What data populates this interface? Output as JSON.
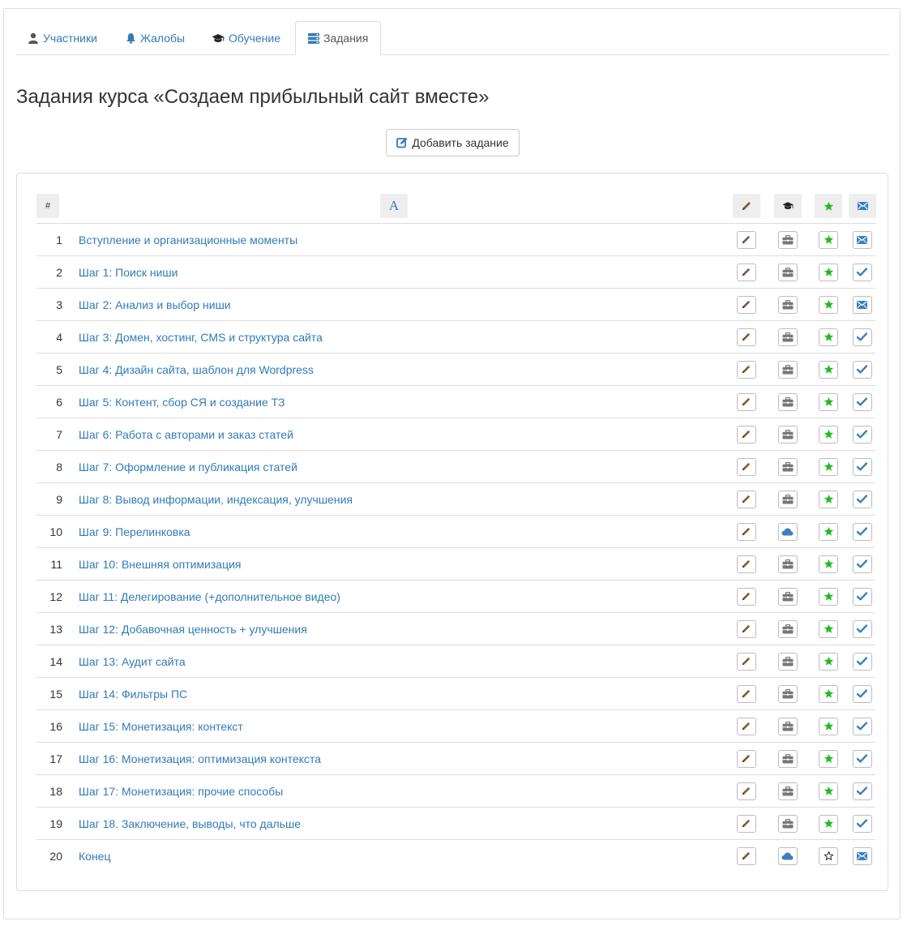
{
  "tabs": [
    {
      "label": "Участники",
      "icon": "user-icon",
      "active": false
    },
    {
      "label": "Жалобы",
      "icon": "bell-icon",
      "active": false
    },
    {
      "label": "Обучение",
      "icon": "graduation-cap-icon",
      "active": false
    },
    {
      "label": "Задания",
      "icon": "tasks-icon",
      "active": true
    }
  ],
  "page": {
    "title": "Задания курса «Создаем прибыльный сайт вместе»",
    "add_button_label": "Добавить задание"
  },
  "table": {
    "headers": {
      "number": "#",
      "title_icon": "font-icon",
      "edit_icon": "pencil-icon",
      "course_icon": "graduation-cap-icon",
      "star_icon": "star-icon",
      "mail_icon": "envelope-icon"
    },
    "rows": [
      {
        "n": "1",
        "title": "Вступление и организационные моменты",
        "type": "briefcase",
        "star": "filled",
        "status": "mail"
      },
      {
        "n": "2",
        "title": "Шаг 1: Поиск ниши",
        "type": "briefcase",
        "star": "filled",
        "status": "check"
      },
      {
        "n": "3",
        "title": "Шаг 2: Анализ и выбор ниши",
        "type": "briefcase",
        "star": "filled",
        "status": "mail"
      },
      {
        "n": "4",
        "title": "Шаг 3: Домен, хостинг, CMS и структура сайта",
        "type": "briefcase",
        "star": "filled",
        "status": "check"
      },
      {
        "n": "5",
        "title": "Шаг 4: Дизайн сайта, шаблон для Wordpress",
        "type": "briefcase",
        "star": "filled",
        "status": "check"
      },
      {
        "n": "6",
        "title": "Шаг 5: Контент, сбор СЯ и создание ТЗ",
        "type": "briefcase",
        "star": "filled",
        "status": "check"
      },
      {
        "n": "7",
        "title": "Шаг 6: Работа с авторами и заказ статей",
        "type": "briefcase",
        "star": "filled",
        "status": "check"
      },
      {
        "n": "8",
        "title": "Шаг 7: Оформление и публикация статей",
        "type": "briefcase",
        "star": "filled",
        "status": "check"
      },
      {
        "n": "9",
        "title": "Шаг 8: Вывод информации, индексация, улучшения",
        "type": "briefcase",
        "star": "filled",
        "status": "check"
      },
      {
        "n": "10",
        "title": "Шаг 9: Перелинковка",
        "type": "cloud",
        "star": "filled",
        "status": "check"
      },
      {
        "n": "11",
        "title": "Шаг 10: Внешняя оптимизация",
        "type": "briefcase",
        "star": "filled",
        "status": "check"
      },
      {
        "n": "12",
        "title": "Шаг 11: Делегирование (+дополнительное видео)",
        "type": "briefcase",
        "star": "filled",
        "status": "check"
      },
      {
        "n": "13",
        "title": "Шаг 12: Добавочная ценность + улучшения",
        "type": "briefcase",
        "star": "filled",
        "status": "check"
      },
      {
        "n": "14",
        "title": "Шаг 13: Аудит сайта",
        "type": "briefcase",
        "star": "filled",
        "status": "check"
      },
      {
        "n": "15",
        "title": "Шаг 14: Фильтры ПС",
        "type": "briefcase",
        "star": "filled",
        "status": "check"
      },
      {
        "n": "16",
        "title": "Шаг 15: Монетизация: контекст",
        "type": "briefcase",
        "star": "filled",
        "status": "check"
      },
      {
        "n": "17",
        "title": "Шаг 16: Монетизация: оптимизация контекста",
        "type": "briefcase",
        "star": "filled",
        "status": "check"
      },
      {
        "n": "18",
        "title": "Шаг 17: Монетизация: прочие способы",
        "type": "briefcase",
        "star": "filled",
        "status": "check"
      },
      {
        "n": "19",
        "title": "Шаг 18. Заключение, выводы, что дальше",
        "type": "briefcase",
        "star": "filled",
        "status": "check"
      },
      {
        "n": "20",
        "title": "Конец",
        "type": "cloud",
        "star": "empty",
        "status": "mail"
      }
    ]
  },
  "colors": {
    "link": "#337ab7",
    "star_green": "#22bb22",
    "pencil_brown": "#8a5a2b",
    "icon_grey": "#777777",
    "check_blue": "#3a7fc2",
    "border": "#dddddd"
  }
}
